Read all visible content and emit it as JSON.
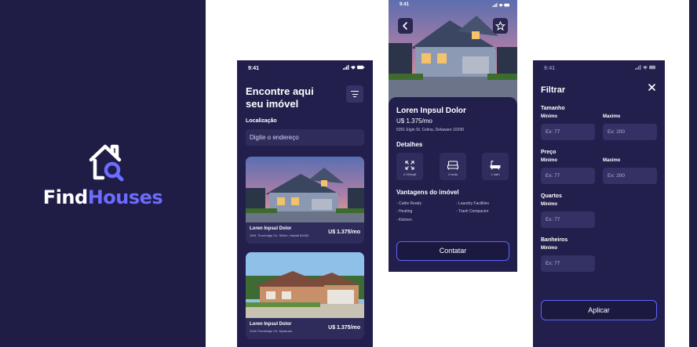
{
  "brand": {
    "word_white": "Find",
    "word_blue": "Houses"
  },
  "status_time": "9:41",
  "home": {
    "title": "Encontre aqui seu imóvel",
    "location_label": "Localização",
    "search_placeholder": "Digite o endereço",
    "listings": [
      {
        "name": "Loren Inpsul Dolor",
        "address": "1901 Thornridge Cir. Shiloh, Hawaii 81063",
        "price": "U$ 1.375/mo"
      },
      {
        "name": "Loren Inpsul Dolor",
        "address": "2118 Thornridge Cir. Syracuse,",
        "price": "U$ 1.375/mo"
      }
    ]
  },
  "detail": {
    "name": "Loren Inpsul Dolor",
    "price": "U$ 1.375/mo",
    "address": "6391 Elgin St. Celina, Delaware 10299",
    "details_heading": "Detalhes",
    "details": [
      {
        "icon": "area-icon",
        "label": "4.765sqft"
      },
      {
        "icon": "bed-icon",
        "label": "2 beds"
      },
      {
        "icon": "bath-icon",
        "label": "1 bath"
      }
    ],
    "features_heading": "Vantagens do imóvel",
    "features_left": [
      "- Cable Ready",
      "- Heating",
      "- Kitchen"
    ],
    "features_right": [
      "- Laundry Facilities",
      "- Trash Compactor"
    ],
    "contact_button": "Contatar",
    "back_icon": "chevron-left-icon",
    "favorite_icon": "star-icon"
  },
  "filter": {
    "title": "Filtrar",
    "close_icon": "close-icon",
    "size_label": "Tamanho",
    "price_label": "Preço",
    "rooms_label": "Quartos",
    "bathrooms_label": "Banheiros",
    "min_label": "Minimo",
    "max_label": "Maximo",
    "min_placeholder": "Ex: 77",
    "max_placeholder": "Ex: 200",
    "apply_button": "Aplicar"
  },
  "colors": {
    "background": "#1f1d45",
    "card": "#2f2c5c",
    "accent": "#6263ff",
    "brand_blue": "#6c6cff"
  }
}
